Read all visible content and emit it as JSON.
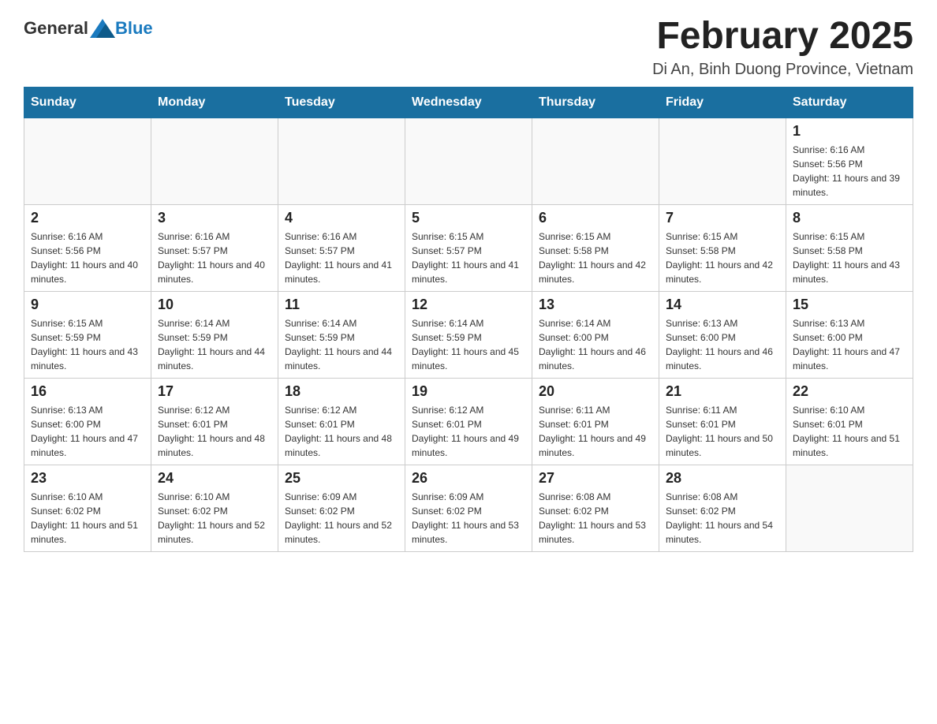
{
  "header": {
    "logo_general": "General",
    "logo_blue": "Blue",
    "month_title": "February 2025",
    "location": "Di An, Binh Duong Province, Vietnam"
  },
  "weekdays": [
    "Sunday",
    "Monday",
    "Tuesday",
    "Wednesday",
    "Thursday",
    "Friday",
    "Saturday"
  ],
  "weeks": [
    [
      {
        "day": "",
        "sunrise": "",
        "sunset": "",
        "daylight": "",
        "empty": true
      },
      {
        "day": "",
        "sunrise": "",
        "sunset": "",
        "daylight": "",
        "empty": true
      },
      {
        "day": "",
        "sunrise": "",
        "sunset": "",
        "daylight": "",
        "empty": true
      },
      {
        "day": "",
        "sunrise": "",
        "sunset": "",
        "daylight": "",
        "empty": true
      },
      {
        "day": "",
        "sunrise": "",
        "sunset": "",
        "daylight": "",
        "empty": true
      },
      {
        "day": "",
        "sunrise": "",
        "sunset": "",
        "daylight": "",
        "empty": true
      },
      {
        "day": "1",
        "sunrise": "Sunrise: 6:16 AM",
        "sunset": "Sunset: 5:56 PM",
        "daylight": "Daylight: 11 hours and 39 minutes.",
        "empty": false
      }
    ],
    [
      {
        "day": "2",
        "sunrise": "Sunrise: 6:16 AM",
        "sunset": "Sunset: 5:56 PM",
        "daylight": "Daylight: 11 hours and 40 minutes.",
        "empty": false
      },
      {
        "day": "3",
        "sunrise": "Sunrise: 6:16 AM",
        "sunset": "Sunset: 5:57 PM",
        "daylight": "Daylight: 11 hours and 40 minutes.",
        "empty": false
      },
      {
        "day": "4",
        "sunrise": "Sunrise: 6:16 AM",
        "sunset": "Sunset: 5:57 PM",
        "daylight": "Daylight: 11 hours and 41 minutes.",
        "empty": false
      },
      {
        "day": "5",
        "sunrise": "Sunrise: 6:15 AM",
        "sunset": "Sunset: 5:57 PM",
        "daylight": "Daylight: 11 hours and 41 minutes.",
        "empty": false
      },
      {
        "day": "6",
        "sunrise": "Sunrise: 6:15 AM",
        "sunset": "Sunset: 5:58 PM",
        "daylight": "Daylight: 11 hours and 42 minutes.",
        "empty": false
      },
      {
        "day": "7",
        "sunrise": "Sunrise: 6:15 AM",
        "sunset": "Sunset: 5:58 PM",
        "daylight": "Daylight: 11 hours and 42 minutes.",
        "empty": false
      },
      {
        "day": "8",
        "sunrise": "Sunrise: 6:15 AM",
        "sunset": "Sunset: 5:58 PM",
        "daylight": "Daylight: 11 hours and 43 minutes.",
        "empty": false
      }
    ],
    [
      {
        "day": "9",
        "sunrise": "Sunrise: 6:15 AM",
        "sunset": "Sunset: 5:59 PM",
        "daylight": "Daylight: 11 hours and 43 minutes.",
        "empty": false
      },
      {
        "day": "10",
        "sunrise": "Sunrise: 6:14 AM",
        "sunset": "Sunset: 5:59 PM",
        "daylight": "Daylight: 11 hours and 44 minutes.",
        "empty": false
      },
      {
        "day": "11",
        "sunrise": "Sunrise: 6:14 AM",
        "sunset": "Sunset: 5:59 PM",
        "daylight": "Daylight: 11 hours and 44 minutes.",
        "empty": false
      },
      {
        "day": "12",
        "sunrise": "Sunrise: 6:14 AM",
        "sunset": "Sunset: 5:59 PM",
        "daylight": "Daylight: 11 hours and 45 minutes.",
        "empty": false
      },
      {
        "day": "13",
        "sunrise": "Sunrise: 6:14 AM",
        "sunset": "Sunset: 6:00 PM",
        "daylight": "Daylight: 11 hours and 46 minutes.",
        "empty": false
      },
      {
        "day": "14",
        "sunrise": "Sunrise: 6:13 AM",
        "sunset": "Sunset: 6:00 PM",
        "daylight": "Daylight: 11 hours and 46 minutes.",
        "empty": false
      },
      {
        "day": "15",
        "sunrise": "Sunrise: 6:13 AM",
        "sunset": "Sunset: 6:00 PM",
        "daylight": "Daylight: 11 hours and 47 minutes.",
        "empty": false
      }
    ],
    [
      {
        "day": "16",
        "sunrise": "Sunrise: 6:13 AM",
        "sunset": "Sunset: 6:00 PM",
        "daylight": "Daylight: 11 hours and 47 minutes.",
        "empty": false
      },
      {
        "day": "17",
        "sunrise": "Sunrise: 6:12 AM",
        "sunset": "Sunset: 6:01 PM",
        "daylight": "Daylight: 11 hours and 48 minutes.",
        "empty": false
      },
      {
        "day": "18",
        "sunrise": "Sunrise: 6:12 AM",
        "sunset": "Sunset: 6:01 PM",
        "daylight": "Daylight: 11 hours and 48 minutes.",
        "empty": false
      },
      {
        "day": "19",
        "sunrise": "Sunrise: 6:12 AM",
        "sunset": "Sunset: 6:01 PM",
        "daylight": "Daylight: 11 hours and 49 minutes.",
        "empty": false
      },
      {
        "day": "20",
        "sunrise": "Sunrise: 6:11 AM",
        "sunset": "Sunset: 6:01 PM",
        "daylight": "Daylight: 11 hours and 49 minutes.",
        "empty": false
      },
      {
        "day": "21",
        "sunrise": "Sunrise: 6:11 AM",
        "sunset": "Sunset: 6:01 PM",
        "daylight": "Daylight: 11 hours and 50 minutes.",
        "empty": false
      },
      {
        "day": "22",
        "sunrise": "Sunrise: 6:10 AM",
        "sunset": "Sunset: 6:01 PM",
        "daylight": "Daylight: 11 hours and 51 minutes.",
        "empty": false
      }
    ],
    [
      {
        "day": "23",
        "sunrise": "Sunrise: 6:10 AM",
        "sunset": "Sunset: 6:02 PM",
        "daylight": "Daylight: 11 hours and 51 minutes.",
        "empty": false
      },
      {
        "day": "24",
        "sunrise": "Sunrise: 6:10 AM",
        "sunset": "Sunset: 6:02 PM",
        "daylight": "Daylight: 11 hours and 52 minutes.",
        "empty": false
      },
      {
        "day": "25",
        "sunrise": "Sunrise: 6:09 AM",
        "sunset": "Sunset: 6:02 PM",
        "daylight": "Daylight: 11 hours and 52 minutes.",
        "empty": false
      },
      {
        "day": "26",
        "sunrise": "Sunrise: 6:09 AM",
        "sunset": "Sunset: 6:02 PM",
        "daylight": "Daylight: 11 hours and 53 minutes.",
        "empty": false
      },
      {
        "day": "27",
        "sunrise": "Sunrise: 6:08 AM",
        "sunset": "Sunset: 6:02 PM",
        "daylight": "Daylight: 11 hours and 53 minutes.",
        "empty": false
      },
      {
        "day": "28",
        "sunrise": "Sunrise: 6:08 AM",
        "sunset": "Sunset: 6:02 PM",
        "daylight": "Daylight: 11 hours and 54 minutes.",
        "empty": false
      },
      {
        "day": "",
        "sunrise": "",
        "sunset": "",
        "daylight": "",
        "empty": true
      }
    ]
  ]
}
